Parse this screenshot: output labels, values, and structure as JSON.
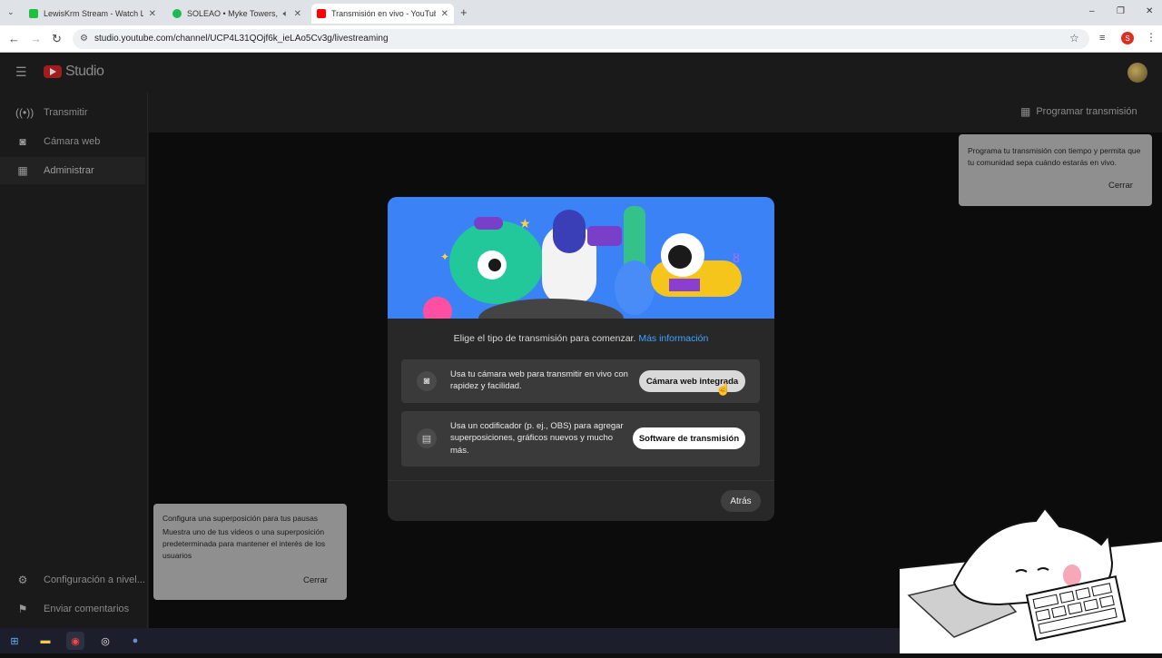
{
  "browser": {
    "tabs": [
      {
        "title": "LewisKrm Stream - Watch Live o",
        "favicon_color": "#1fbf3f"
      },
      {
        "title": "SOLEAO • Myke Towers, Qu",
        "favicon_color": "#1db954"
      },
      {
        "title": "Transmisión en vivo - YouTube",
        "favicon_color": "#ff0000"
      }
    ],
    "new_tab": "+",
    "url": "studio.youtube.com/channel/UCP4L31QOjf6k_ieLAo5Cv3g/livestreaming",
    "profile_initial": "S",
    "window_controls": [
      "–",
      "❐",
      "✕"
    ]
  },
  "studio": {
    "logo_text": "Studio",
    "sidebar": [
      {
        "label": "Transmitir",
        "icon": "broadcast-icon"
      },
      {
        "label": "Cámara web",
        "icon": "camera-icon"
      },
      {
        "label": "Administrar",
        "icon": "calendar-icon"
      }
    ],
    "sidebar_bottom": [
      {
        "label": "Configuración a nivel...",
        "icon": "gear-icon"
      },
      {
        "label": "Enviar comentarios",
        "icon": "feedback-icon"
      }
    ],
    "program_button": "Programar transmisión",
    "schedule_tooltip": {
      "text": "Programa tu transmisión con tiempo y permita que tu comunidad sepa cuándo estarás en vivo.",
      "close": "Cerrar"
    },
    "pause_tooltip": {
      "title": "Configura una superposición para tus pausas",
      "text": "Muestra uno de tus videos o una superposición predeterminada para mantener el interés de los usuarios",
      "close": "Cerrar"
    },
    "modal": {
      "lead": "Elige el tipo de transmisión para comenzar.",
      "lead_link": "Más información",
      "options": [
        {
          "text": "Usa tu cámara web para transmitir en vivo con rapidez y facilidad.",
          "button": "Cámara web integrada",
          "icon": "camera-icon"
        },
        {
          "text": "Usa un codificador (p. ej., OBS) para agregar superposiciones, gráficos nuevos y mucho más.",
          "button": "Software de transmisión",
          "icon": "encoder-icon"
        }
      ],
      "back": "Atrás"
    }
  },
  "colors": {
    "accent_link": "#3ea6ff",
    "youtube_red": "#ff0000",
    "hero_blue": "#3b82f6"
  }
}
